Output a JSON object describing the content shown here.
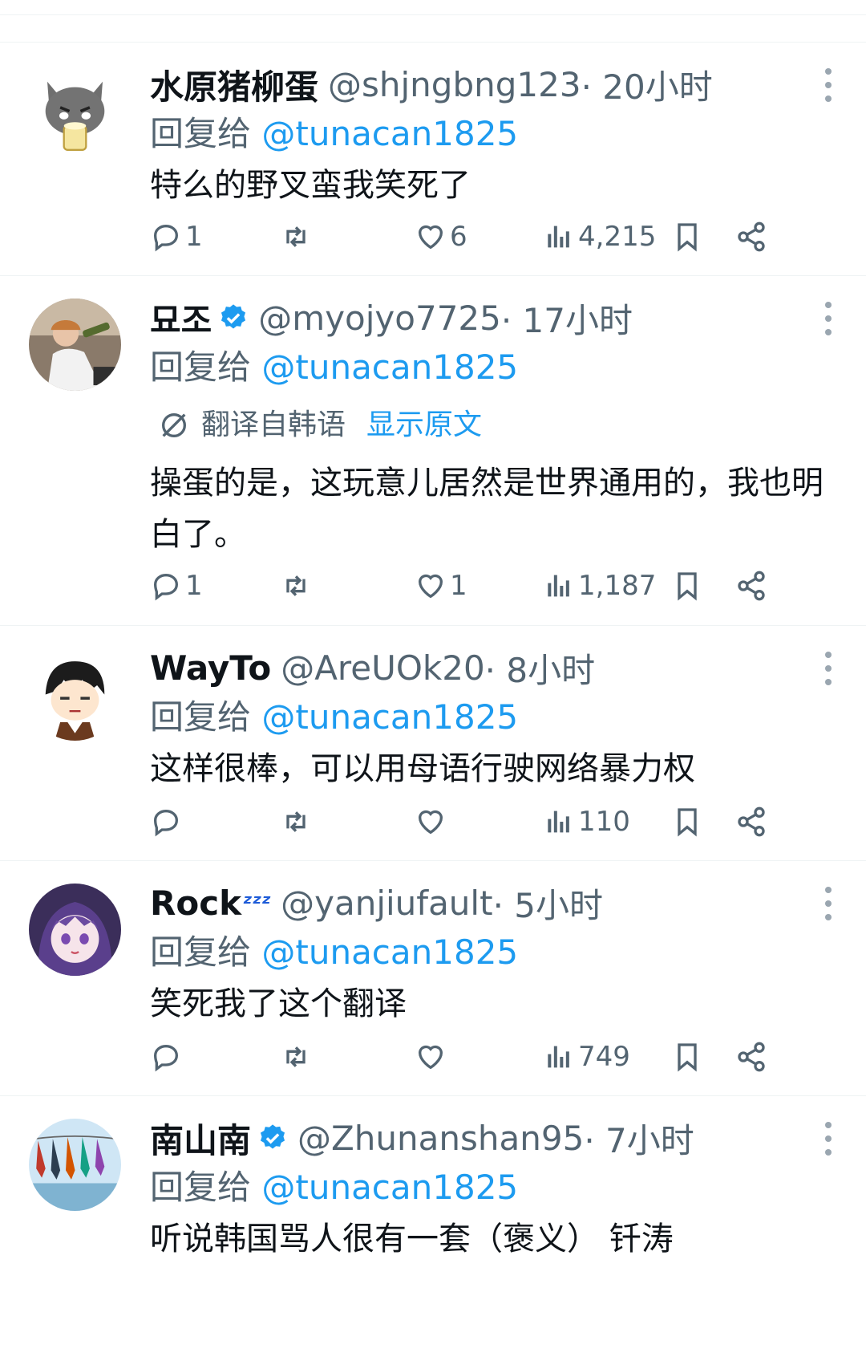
{
  "colors": {
    "accent": "#1d9bf0",
    "secondary_text": "#536471",
    "primary_text": "#0f1419",
    "divider": "#eff3f4"
  },
  "tweets": [
    {
      "name": "水原猪柳蛋",
      "verified": false,
      "handle": "@shjngbng123",
      "time": " · 20小时",
      "reply_prefix": "回复给 ",
      "reply_to": "@tunacan1825",
      "text": "特么的野叉蛮我笑死了",
      "replies": "1",
      "likes": "6",
      "views": "4,215",
      "avatar_icon": "gray-cat-avatar"
    },
    {
      "name": "묘조",
      "verified": true,
      "handle": "@myojyo7725",
      "time": " · 17小时",
      "reply_prefix": "回复给 ",
      "reply_to": "@tunacan1825",
      "translated": "翻译自韩语",
      "show_original": "显示原文",
      "text": "操蛋的是，这玩意儿居然是世界通用的，我也明白了。",
      "replies": "1",
      "likes": "1",
      "views": "1,187",
      "avatar_icon": "photo-avatar"
    },
    {
      "name": "WayTo",
      "verified": false,
      "handle": "@AreUOk20",
      "time": " · 8小时",
      "reply_prefix": "回复给 ",
      "reply_to": "@tunacan1825",
      "text": "这样很棒，可以用母语行驶网络暴力权",
      "replies": "",
      "likes": "",
      "views": "110",
      "avatar_icon": "anime-boy-avatar"
    },
    {
      "name": "Rock",
      "name_emoji": "ᶻᶻᶻ",
      "verified": false,
      "handle": "@yanjiufault",
      "time": " · 5小时",
      "reply_prefix": "回复给 ",
      "reply_to": "@tunacan1825",
      "text": "笑死我了这个翻译",
      "replies": "",
      "likes": "",
      "views": "749",
      "avatar_icon": "anime-girl-avatar"
    },
    {
      "name": "南山南",
      "verified": true,
      "handle": "@Zhunanshan95",
      "time": " · 7小时",
      "reply_prefix": "回复给 ",
      "reply_to": "@tunacan1825",
      "text": "听说韩国骂人很有一套（褒义） 钎涛",
      "avatar_icon": "koinobori-avatar"
    }
  ]
}
